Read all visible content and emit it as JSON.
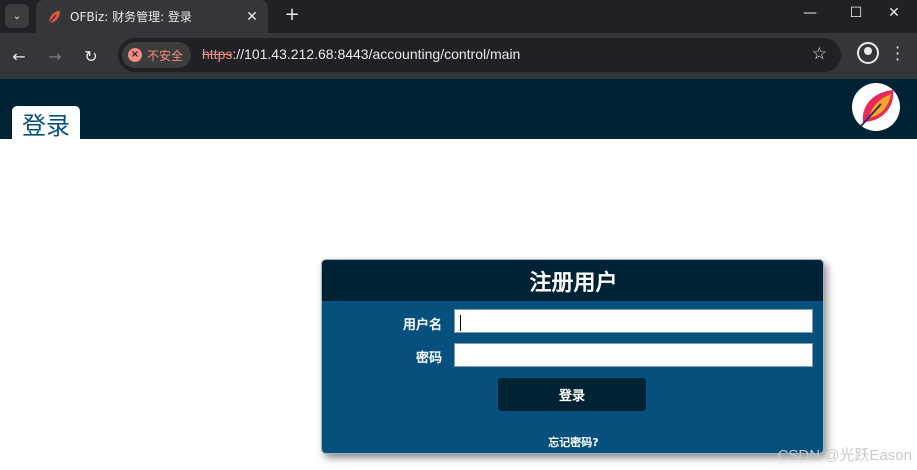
{
  "browser": {
    "tab": {
      "title": "OFBiz: 财务管理: 登录"
    },
    "security_chip": "不安全",
    "url": {
      "scheme": "https",
      "rest": "://101.43.212.68:8443/accounting/control/main"
    }
  },
  "header": {
    "tab_label": "登录"
  },
  "login": {
    "title": "注册用户",
    "username_label": "用户名",
    "username_value": "",
    "password_label": "密码",
    "password_value": "",
    "submit_label": "登录",
    "forgot_link": "忘记密码?"
  },
  "watermark": "CSDN @光跃Eason",
  "colors": {
    "header_bg": "#002235",
    "form_bg": "#05507c",
    "browser_dark": "#202124",
    "insecure_red": "#f28b82"
  },
  "icons": [
    "tab-list-icon",
    "ofbiz-favicon",
    "close-icon",
    "plus-icon",
    "minimize-icon",
    "maximize-icon",
    "window-close-icon",
    "back-icon",
    "forward-icon",
    "reload-icon",
    "insecure-icon",
    "star-icon",
    "profile-icon",
    "menu-icon",
    "ofbiz-logo-icon"
  ]
}
